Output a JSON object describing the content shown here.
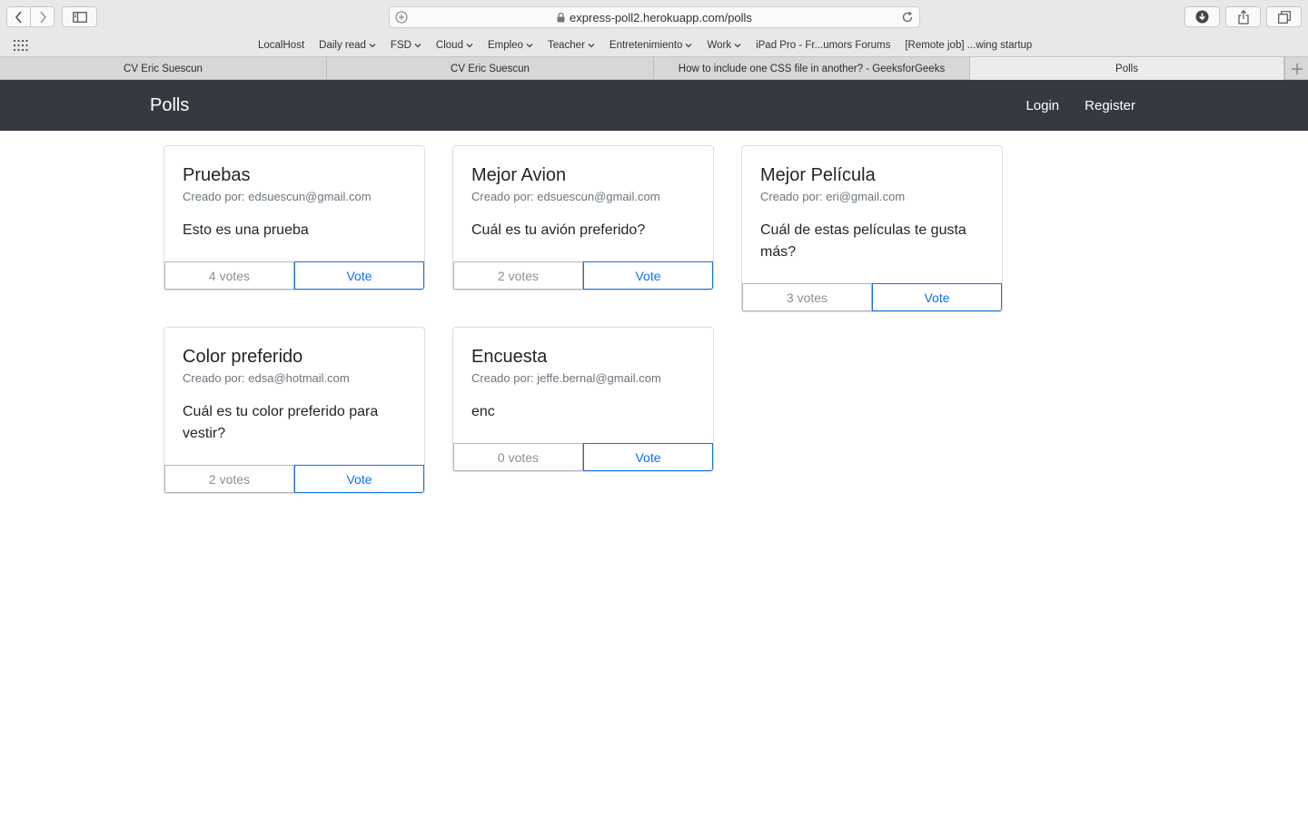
{
  "browser": {
    "url": "express-poll2.herokuapp.com/polls",
    "bookmarks": [
      {
        "label": "LocalHost",
        "dropdown": false
      },
      {
        "label": "Daily read",
        "dropdown": true
      },
      {
        "label": "FSD",
        "dropdown": true
      },
      {
        "label": "Cloud",
        "dropdown": true
      },
      {
        "label": "Empleo",
        "dropdown": true
      },
      {
        "label": "Teacher",
        "dropdown": true
      },
      {
        "label": "Entretenimiento",
        "dropdown": true
      },
      {
        "label": "Work",
        "dropdown": true
      },
      {
        "label": "iPad Pro - Fr...umors Forums",
        "dropdown": false
      },
      {
        "label": "[Remote job] ...wing startup",
        "dropdown": false
      }
    ],
    "tabs": [
      {
        "label": "CV Eric Suescun",
        "active": false
      },
      {
        "label": "CV Eric Suescun",
        "active": false
      },
      {
        "label": "How to include one CSS file in another? - GeeksforGeeks",
        "active": false
      },
      {
        "label": "Polls",
        "active": true
      }
    ]
  },
  "navbar": {
    "brand": "Polls",
    "login": "Login",
    "register": "Register",
    "bg_color": "#343a40"
  },
  "polls": [
    {
      "title": "Pruebas",
      "creator": "Creado por: edsuescun@gmail.com",
      "question": "Esto es una prueba",
      "votes": "4 votes",
      "vote_label": "Vote"
    },
    {
      "title": "Mejor Avion",
      "creator": "Creado por: edsuescun@gmail.com",
      "question": "Cuál es tu avión preferido?",
      "votes": "2 votes",
      "vote_label": "Vote"
    },
    {
      "title": "Mejor Película",
      "creator": "Creado por: eri@gmail.com",
      "question": "Cuál de estas películas te gusta más?",
      "votes": "3 votes",
      "vote_label": "Vote"
    },
    {
      "title": "Color preferido",
      "creator": "Creado por: edsa@hotmail.com",
      "question": "Cuál es tu color preferido para vestir?",
      "votes": "2 votes",
      "vote_label": "Vote"
    },
    {
      "title": "Encuesta",
      "creator": "Creado por: jeffe.bernal@gmail.com",
      "question": "enc",
      "votes": "0 votes",
      "vote_label": "Vote"
    }
  ],
  "icons": {
    "back": "chevron-left-icon",
    "forward": "chevron-right-icon",
    "sidebar": "sidebar-icon",
    "lock": "lock-icon",
    "reload": "reload-icon",
    "download": "download-icon",
    "share": "share-icon",
    "tabs": "tabs-overview-icon",
    "apps": "apps-grid-icon",
    "new_tab": "plus-icon"
  },
  "colors": {
    "primary": "#0d6efd",
    "muted": "#6c757d"
  }
}
